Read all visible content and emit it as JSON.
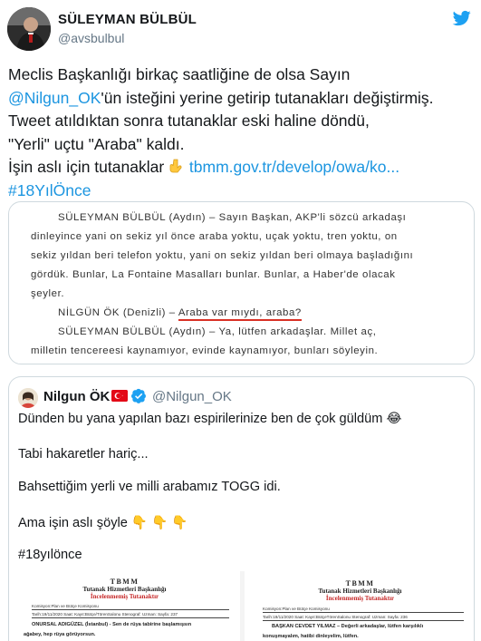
{
  "author": {
    "display_name": "SÜLEYMAN BÜLBÜL",
    "handle": "@avsbulbul"
  },
  "tweet": {
    "line1": "Meclis Başkanlığı birkaç saatliğine de olsa Sayın",
    "mention": "@Nilgun_OK",
    "line2_rest": "'ün isteğini yerine getirip tutanakları değiştirmiş.",
    "line3": "Tweet atıldıktan sonra tutanaklar eski haline döndü,",
    "line4": "\"Yerli\" uçtu \"Araba\" kaldı.",
    "line5_text": "İşin aslı için tutanaklar",
    "link": "tbmm.gov.tr/develop/owa/ko...",
    "hashtag": "#18YılÖnce"
  },
  "document": {
    "para1_l1": "SÜLEYMAN BÜLBÜL (Aydın) – Sayın Başkan, AKP'li sözcü arkadaşı",
    "para1_l2": "dinleyince yani on sekiz yıl önce araba yoktu, uçak yoktu, tren yoktu, on",
    "para1_l3": "sekiz yıldan beri telefon yoktu, yani on sekiz yıldan beri olmaya başladığını",
    "para1_l4": "gördük. Bunlar, La Fontaine  Masalları bunlar. Bunlar, a Haber'de olacak",
    "para1_l5": "şeyler.",
    "para2_speaker": "NİLGÜN ÖK (Denizli) –",
    "para2_underlined": "Araba var mıydı, araba?",
    "para3_l1": "SÜLEYMAN BÜLBÜL (Aydın) – Ya, lütfen arkadaşlar. Millet aç,",
    "para3_l2": "milletin tencereesi kaynamıyor, evinde kaynamıyor, bunları söyleyin."
  },
  "quoted_tweet": {
    "name": "Nilgun ÖK",
    "handle": "@Nilgun_OK",
    "line1": "Dünden bu yana yapılan bazı espirilerinize ben de çok güldüm",
    "line2": "Tabi hakaretler hariç...",
    "line3": "Bahsettiğim yerli ve milli arabamız TOGG idi.",
    "line4": "Ama işin aslı şöyle",
    "hashtag": "#18yılönce",
    "emoji_laugh": "😂",
    "emoji_hands": "👇👇👇"
  },
  "quoted_docs": {
    "left": {
      "org": "TBMM",
      "title1": "Tutanak Hizmetleri Başkanlığı",
      "title2": "İncelenmemiş Tutanaktır",
      "meta1": "Komisyon:Plan ve Bütçe Komisyonu",
      "meta2": "Tarih:19/11/2020     Saat:        Kayıt:Bütçe/TörenSalonu   Stenograf:          Uzman:           Sayfa: 237",
      "body1": "ONURSAL ADIGÜZEL (İstanbul) -  Sen de rüya tabirine başlamışsın",
      "body2": "ağabey, hep rüya görüyorsun."
    },
    "right": {
      "org": "TBMM",
      "title1": "Tutanak Hizmetleri Başkanlığı",
      "title2": "İncelenmemiş Tutanaktır",
      "meta1": "Komisyon:Plan ve Bütçe Komisyonu",
      "meta2": "Tarih:19/11/2020     Saat:        Kayıt:BütçeTörenSalonu   Stenograf:          Uzman:           Sayfa: 236",
      "body1": "BAŞKAN CEVDET YILMAZ – Değerli arkadaşlar, lütfen karşılıklı",
      "body2": "konuşmayalım, hatibi dinleyelim, lütfen."
    }
  },
  "colors": {
    "link": "#1b95e0",
    "twitter_blue": "#1da1f2",
    "underline_red": "#d93025"
  },
  "icons": {
    "brand": "twitter-bird-icon",
    "verified": "verified-badge-icon",
    "flag": "turkey-flag-icon",
    "pointing": "backhand-index-pointing-down-icon"
  }
}
